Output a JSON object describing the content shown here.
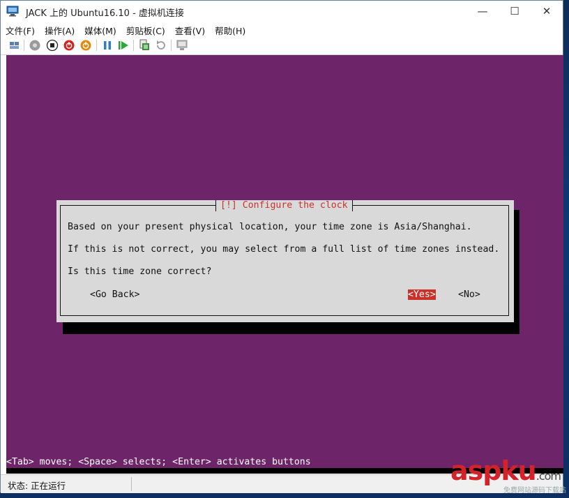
{
  "window": {
    "title": "JACK 上的 Ubuntu16.10 - 虚拟机连接",
    "minimize": "—",
    "maximize": "☐",
    "close": "✕"
  },
  "menu": [
    "文件(F)",
    "操作(A)",
    "媒体(M)",
    "剪贴板(C)",
    "查看(V)",
    "帮助(H)"
  ],
  "toolbar": {
    "icons": [
      "ctrl-alt-del-icon",
      "start-icon",
      "turn-off-icon",
      "shutdown-icon",
      "save-icon",
      "pause-icon",
      "resume-icon",
      "checkpoint-icon",
      "revert-icon",
      "enhanced-session-icon"
    ]
  },
  "dialog": {
    "title": "[!] Configure the clock",
    "line1": "Based on your present physical location, your time zone is Asia/Shanghai.",
    "line2": "If this is not correct, you may select from a full list of time zones instead.",
    "question": "Is this time zone correct?",
    "go_back": "<Go Back>",
    "yes": "<Yes>",
    "no": "<No>"
  },
  "hint": "<Tab> moves; <Space> selects; <Enter> activates buttons",
  "status": "状态: 正在运行",
  "watermark": {
    "logo": "aspku",
    "suffix": ".com",
    "tagline": "免费网站源码下载站"
  },
  "colors": {
    "installer_bg": "#6e2468",
    "dialog_bg": "#d9d9d9",
    "accent_red": "#c8322a"
  }
}
